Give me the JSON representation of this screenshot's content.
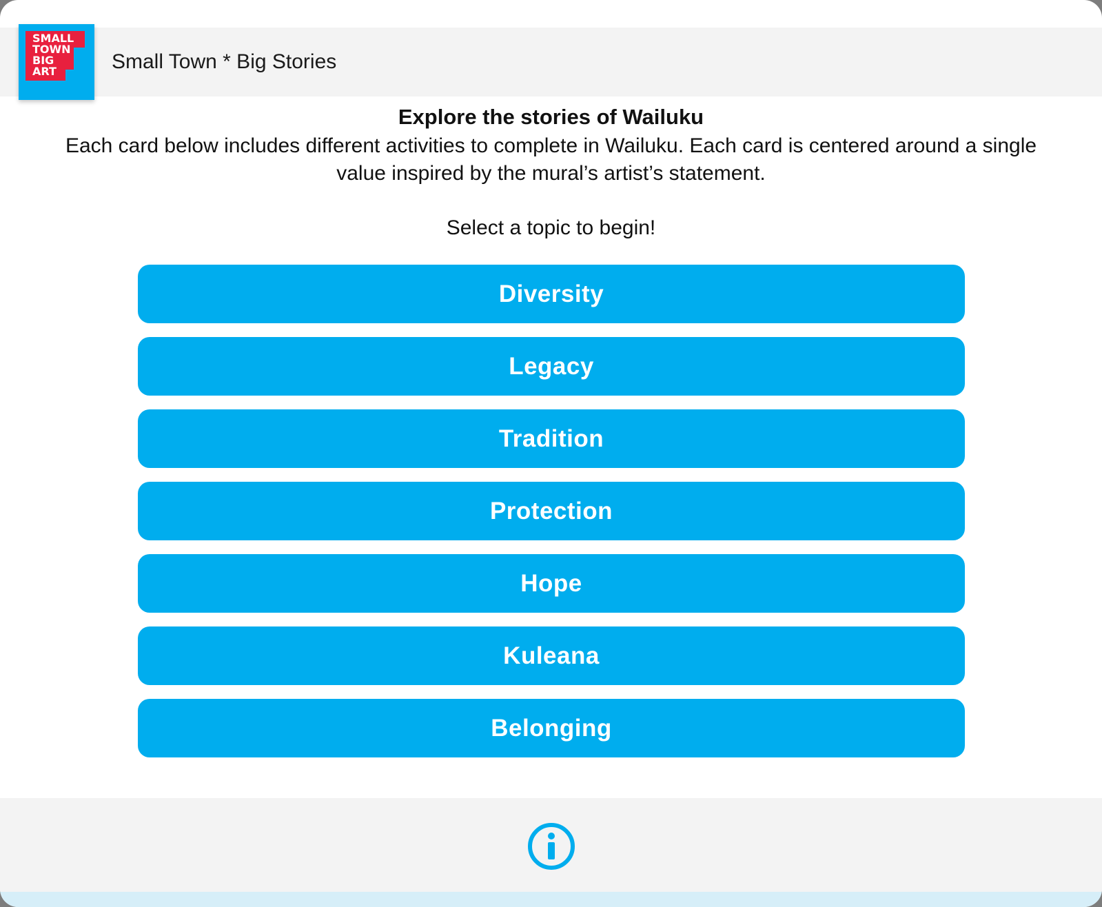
{
  "header": {
    "logo_text": [
      "SMALL",
      "TOWN",
      "BIG",
      "ART"
    ],
    "app_title": "Small Town * Big Stories"
  },
  "intro": {
    "heading": "Explore the stories of Wailuku",
    "body": "Each card below includes different activities to complete in Wailuku. Each card is centered around a single value inspired by the mural’s artist’s statement.",
    "prompt": "Select a topic to begin!"
  },
  "topics": [
    {
      "label": "Diversity"
    },
    {
      "label": "Legacy"
    },
    {
      "label": "Tradition"
    },
    {
      "label": "Protection"
    },
    {
      "label": "Hope"
    },
    {
      "label": "Kuleana"
    },
    {
      "label": "Belonging"
    }
  ],
  "footer": {
    "info_icon": "info-icon"
  },
  "colors": {
    "accent": "#00adee",
    "logo_red": "#e8203e",
    "header_bg": "#f3f3f3",
    "text": "#111111"
  }
}
